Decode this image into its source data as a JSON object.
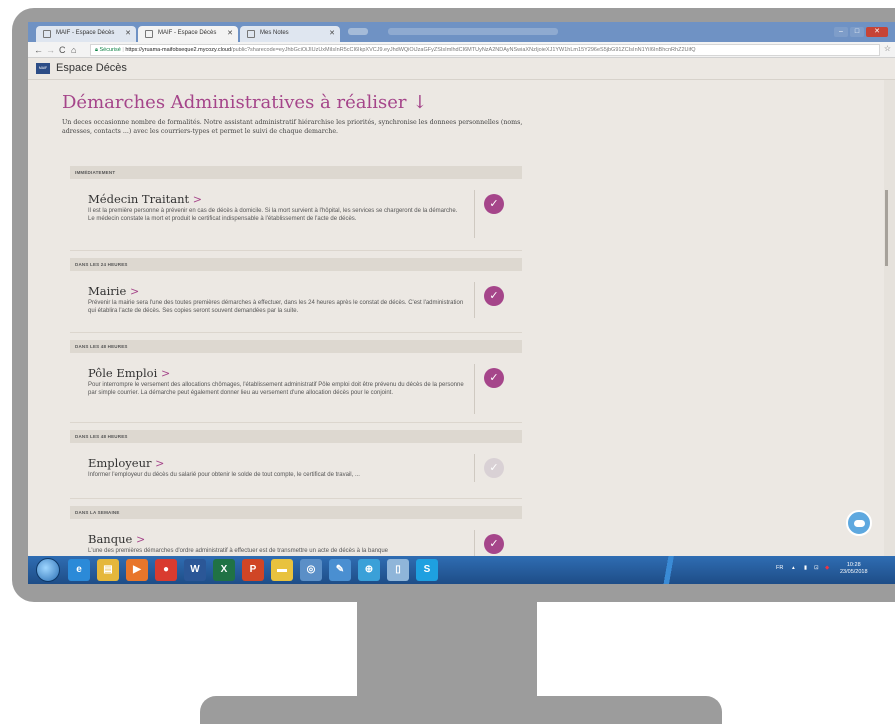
{
  "browser": {
    "tabs": [
      {
        "label": "MAIF - Espace Décès"
      },
      {
        "label": "MAIF - Espace Décès"
      },
      {
        "label": "Mes Notes"
      }
    ],
    "security_label": "Sécurisé",
    "url_host": "https://yruama-maifobseque2.mycozy.cloud",
    "url_path": "/public?sharecode=eyJhbGciOiJIUzUxMiIsInR5cCI6IkpXVCJ9.eyJhdWQiOiJzaGFyZSIsImlhdCI6MTUyNzA2NDAyNSwiaXNzIjoieXJ1YW1hLm15Y296eS5jbG91ZCIsInN1YiI6InBhcnRhZ2UifQ",
    "nav_back": "←",
    "nav_forward": "→",
    "nav_reload": "C",
    "nav_home": "⌂",
    "star": "☆",
    "win_min": "–",
    "win_max": "□",
    "win_close": "✕"
  },
  "app": {
    "title": "Espace Décès",
    "logo_text": "MAIF"
  },
  "page": {
    "heading": "Démarches Administratives à réaliser ↓",
    "intro": "Un deces occasionne nombre de formalités. Notre assistant administratif hiérarchise les priorités, synchronise les donnees personnelles (noms, adresses, contacts ...) avec les courriers-types et permet le suivi de chaque demarche."
  },
  "tasks": [
    {
      "section": "IMMÉDIATEMENT",
      "title": "Médecin Traitant",
      "arrow": ">",
      "description": "Il est la première personne à prévenir en cas de décès à domicile. Si la mort survient à l'hôpital, les services se chargeront de la démarche. Le médecin constate la mort et produit le certificat indispensable à l'établissement de l'acte de décès.",
      "done": true
    },
    {
      "section": "DANS LES 24 HEURES",
      "title": "Mairie",
      "arrow": ">",
      "description": "Prévenir la mairie sera l'une des toutes premières démarches à effectuer, dans les 24 heures après le constat de décès. C'est l'administration qui établira l'acte de décès. Ses copies seront souvent demandées par la suite.",
      "done": true
    },
    {
      "section": "DANS LES 48 HEURES",
      "title": "Pôle Emploi",
      "arrow": ">",
      "description": "Pour interrompre le versement des allocations chômages, l'établissement administratif Pôle emploi doit être prévenu du décès de la personne par simple courrier. La démarche peut également donner lieu au versement d'une allocation décès pour le conjoint.",
      "done": true
    },
    {
      "section": "DANS LES 48 HEURES",
      "title": "Employeur",
      "arrow": ">",
      "description": "Informer l'employeur du décès du salarié pour obtenir le solde de tout compte, le certificat de travail, ...",
      "done": false
    },
    {
      "section": "DANS LA SEMAINE",
      "title": "Banque",
      "arrow": ">",
      "description": "L'une des premières démarches d'ordre administratif à effectuer est de transmettre un acte de décès à la banque",
      "done": true
    }
  ],
  "taskbar": {
    "apps": [
      {
        "name": "ie-icon",
        "glyph": "e",
        "color": "#2b8ad8"
      },
      {
        "name": "explorer-icon",
        "glyph": "▤",
        "color": "#e5b73b"
      },
      {
        "name": "media-player-icon",
        "glyph": "▶",
        "color": "#e8762b"
      },
      {
        "name": "chrome-icon",
        "glyph": "●",
        "color": "#d93b2f"
      },
      {
        "name": "word-icon",
        "glyph": "W",
        "color": "#2b5797"
      },
      {
        "name": "excel-icon",
        "glyph": "X",
        "color": "#207245"
      },
      {
        "name": "powerpoint-icon",
        "glyph": "P",
        "color": "#d04525"
      },
      {
        "name": "folder-icon",
        "glyph": "▬",
        "color": "#e8c23e"
      },
      {
        "name": "network-icon",
        "glyph": "◎",
        "color": "#5b8fc7"
      },
      {
        "name": "paint-icon",
        "glyph": "✎",
        "color": "#4a8fd1"
      },
      {
        "name": "globe-icon",
        "glyph": "⊕",
        "color": "#3aa0d8"
      },
      {
        "name": "notepad-icon",
        "glyph": "▯",
        "color": "#8fb5d9"
      },
      {
        "name": "skype-icon",
        "glyph": "S",
        "color": "#1ea0e0"
      }
    ],
    "lang": "FR",
    "time": "10:28",
    "date": "23/05/2018"
  }
}
